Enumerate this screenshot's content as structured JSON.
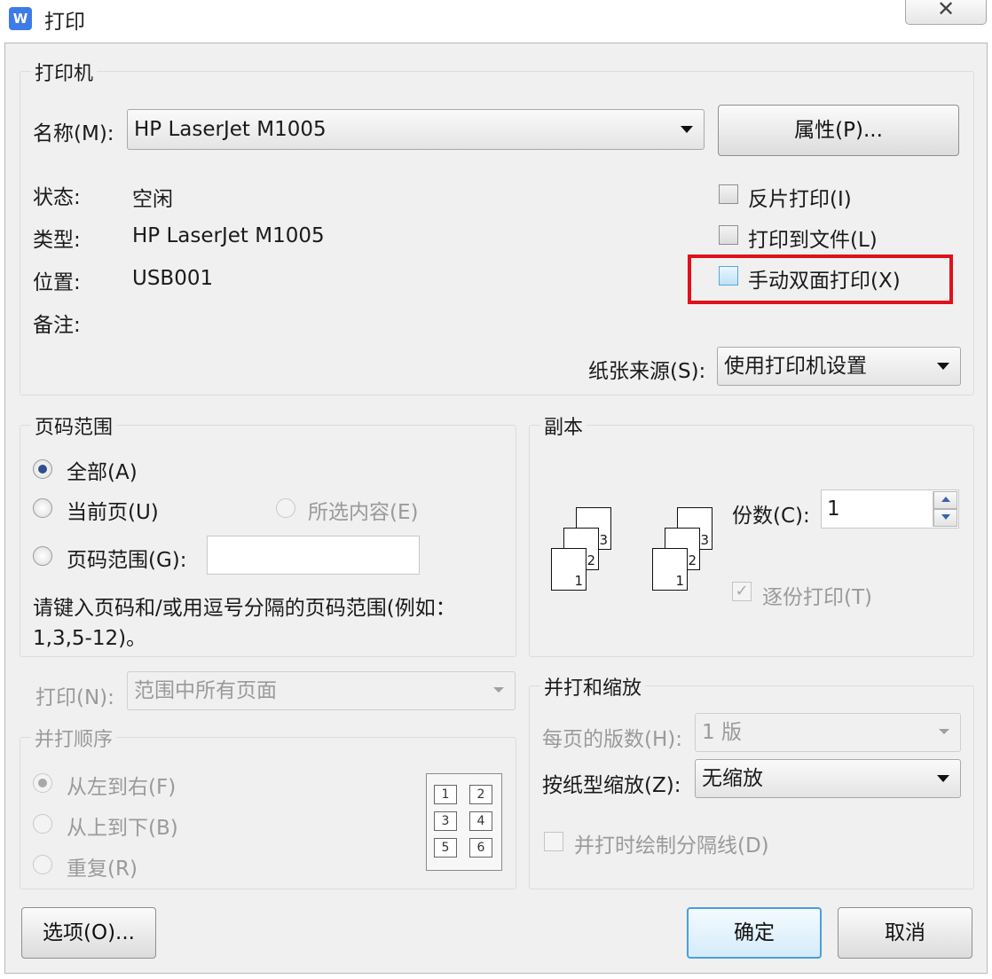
{
  "window": {
    "app_icon": "W",
    "title": "打印",
    "close_glyph": "✕"
  },
  "printer": {
    "group_label": "打印机",
    "name_label": "名称(M):",
    "name_value": "HP LaserJet M1005",
    "properties_button": "属性(P)...",
    "status_label": "状态:",
    "status_value": "空闲",
    "type_label": "类型:",
    "type_value": "HP LaserJet M1005",
    "location_label": "位置:",
    "location_value": "USB001",
    "comment_label": "备注:",
    "reverse_print": "反片打印(I)",
    "print_to_file": "打印到文件(L)",
    "manual_duplex": "手动双面打印(X)",
    "paper_source_label": "纸张来源(S):",
    "paper_source_value": "使用打印机设置"
  },
  "page_range": {
    "group_label": "页码范围",
    "all": "全部(A)",
    "current_page": "当前页(U)",
    "selection": "所选内容(E)",
    "pages": "页码范围(G):",
    "pages_value": "",
    "hint_line1": "请键入页码和/或用逗号分隔的页码范围(例如：",
    "hint_line2": "1,3,5-12)。"
  },
  "copies": {
    "group_label": "副本",
    "count_label": "份数(C):",
    "count_value": "1",
    "collate": "逐份打印(T)",
    "page_numbers": [
      "1",
      "2",
      "3"
    ],
    "collate_check": "✓"
  },
  "print_what": {
    "label": "打印(N):",
    "value": "范围中所有页面"
  },
  "order": {
    "group_label": "并打顺序",
    "left_to_right": "从左到右(F)",
    "top_to_bottom": "从上到下(B)",
    "repeat": "重复(R)",
    "grid_numbers": [
      "1",
      "2",
      "3",
      "4",
      "5",
      "6"
    ]
  },
  "zoom": {
    "group_label": "并打和缩放",
    "pages_per_sheet_label": "每页的版数(H):",
    "pages_per_sheet_value": "1 版",
    "scale_label": "按纸型缩放(Z):",
    "scale_value": "无缩放",
    "draw_borders": "并打时绘制分隔线(D)"
  },
  "buttons": {
    "options": "选项(O)...",
    "ok": "确定",
    "cancel": "取消"
  },
  "colors": {
    "highlight": "#e0111b",
    "primary_border": "#4a9fd9",
    "dialog_bg": "#f0f0f0"
  }
}
